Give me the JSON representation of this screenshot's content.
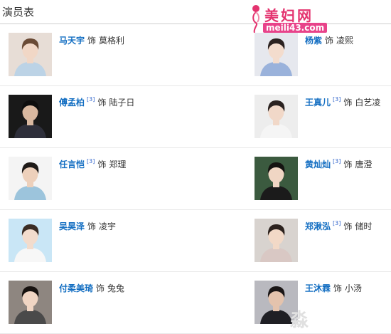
{
  "header": {
    "title": "演员表"
  },
  "watermark": {
    "name": "美妇网",
    "url": "meili43.com",
    "overlay_char": "淼"
  },
  "connector": "饰",
  "cast": [
    {
      "left": {
        "actor": "马天宇",
        "note": "",
        "role": "莫格利",
        "photo": {
          "bg": "#e7ddd6",
          "skin": "#f1d7c6",
          "hair": "#6a4a35",
          "shirt": "#bcd3e6"
        }
      },
      "right": {
        "actor": "杨紫",
        "note": "",
        "role": "凌熙",
        "photo": {
          "bg": "#e6e8ee",
          "skin": "#f3dccd",
          "hair": "#2b2220",
          "shirt": "#9ab2db"
        }
      }
    },
    {
      "left": {
        "actor": "傅孟柏",
        "note": "[3]",
        "role": "陆子日",
        "photo": {
          "bg": "#191919",
          "skin": "#d9b8a0",
          "hair": "#0e0e0e",
          "shirt": "#2e2f3a"
        }
      },
      "right": {
        "actor": "王真儿",
        "note": "[3]",
        "role": "白艺凌",
        "photo": {
          "bg": "#ededed",
          "skin": "#f1d8c8",
          "hair": "#2a2220",
          "shirt": "#f5f5f5"
        }
      }
    },
    {
      "left": {
        "actor": "任言恺",
        "note": "[3]",
        "role": "郑理",
        "photo": {
          "bg": "#f4f4f4",
          "skin": "#edd0bb",
          "hair": "#1e1a18",
          "shirt": "#9cc4dc"
        }
      },
      "right": {
        "actor": "黄灿灿",
        "note": "[3]",
        "role": "唐澄",
        "photo": {
          "bg": "#3b5a3f",
          "skin": "#f0d6c4",
          "hair": "#151311",
          "shirt": "#1b1b1b"
        }
      }
    },
    {
      "left": {
        "actor": "吴昊泽",
        "note": "",
        "role": "凌宇",
        "photo": {
          "bg": "#c9e6f6",
          "skin": "#f2dccd",
          "hair": "#3a2c24",
          "shirt": "#f7f7f7"
        }
      },
      "right": {
        "actor": "郑湫泓",
        "note": "[3]",
        "role": "储时",
        "photo": {
          "bg": "#d8d3cf",
          "skin": "#f2d9c7",
          "hair": "#2b211d",
          "shirt": "#d9c8c4"
        }
      }
    },
    {
      "left": {
        "actor": "付柔美琦",
        "note": "",
        "role": "兔兔",
        "photo": {
          "bg": "#8e8680",
          "skin": "#f0d5c3",
          "hair": "#17120f",
          "shirt": "#4a4a4a"
        }
      },
      "right": {
        "actor": "王沐霖",
        "note": "",
        "role": "小汤",
        "photo": {
          "bg": "#b9b9bf",
          "skin": "#e4c3ad",
          "hair": "#1a1616",
          "shirt": "#1f1f24"
        }
      }
    }
  ]
}
